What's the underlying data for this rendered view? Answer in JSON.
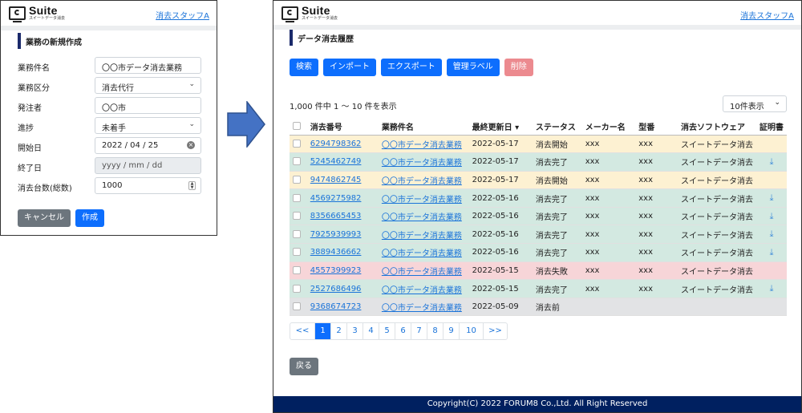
{
  "app": {
    "logo_title": "Suite",
    "logo_subtitle": "スイートデータ消去",
    "user": "消去スタッフA"
  },
  "new_job": {
    "title": "業務の新規作成",
    "fields": [
      {
        "label": "業務件名",
        "value": "〇〇市データ消去業務",
        "kind": "text"
      },
      {
        "label": "業務区分",
        "value": "消去代行",
        "kind": "select"
      },
      {
        "label": "発注者",
        "value": "〇〇市",
        "kind": "text"
      },
      {
        "label": "進捗",
        "value": "未着手",
        "kind": "select"
      },
      {
        "label": "開始日",
        "value": "2022 / 04 / 25",
        "kind": "date"
      },
      {
        "label": "終了日",
        "value": "yyyy / mm / dd",
        "kind": "disabled"
      },
      {
        "label": "消去台数(総数)",
        "value": "1000",
        "kind": "number"
      }
    ],
    "cancel_label": "キャンセル",
    "create_label": "作成"
  },
  "history": {
    "title": "データ消去履歴",
    "actions": {
      "search": "検索",
      "import": "インポート",
      "export": "エクスポート",
      "labels": "管理ラベル",
      "delete": "削除"
    },
    "count_text": "1,000 件中 1 〜 10 件を表示",
    "per_page": "10件表示",
    "columns": [
      "消去番号",
      "業務件名",
      "最終更新日 ▾",
      "ステータス",
      "メーカー名",
      "型番",
      "消去ソフトウェア",
      "証明書"
    ],
    "rows": [
      {
        "id": "6294798362",
        "job": "〇〇市データ消去業務",
        "date": "2022-05-17",
        "status": "消去開始",
        "maker": "xxx",
        "model": "xxx",
        "software": "スイートデータ消去",
        "cert": "",
        "state": "start"
      },
      {
        "id": "5245462749",
        "job": "〇〇市データ消去業務",
        "date": "2022-05-17",
        "status": "消去完了",
        "maker": "xxx",
        "model": "xxx",
        "software": "スイートデータ消去",
        "cert": "download-icon",
        "state": "done"
      },
      {
        "id": "9474862745",
        "job": "〇〇市データ消去業務",
        "date": "2022-05-17",
        "status": "消去開始",
        "maker": "xxx",
        "model": "xxx",
        "software": "スイートデータ消去",
        "cert": "",
        "state": "start"
      },
      {
        "id": "4569275982",
        "job": "〇〇市データ消去業務",
        "date": "2022-05-16",
        "status": "消去完了",
        "maker": "xxx",
        "model": "xxx",
        "software": "スイートデータ消去",
        "cert": "download-icon",
        "state": "done"
      },
      {
        "id": "8356665453",
        "job": "〇〇市データ消去業務",
        "date": "2022-05-16",
        "status": "消去完了",
        "maker": "xxx",
        "model": "xxx",
        "software": "スイートデータ消去",
        "cert": "download-icon",
        "state": "done"
      },
      {
        "id": "7925939993",
        "job": "〇〇市データ消去業務",
        "date": "2022-05-16",
        "status": "消去完了",
        "maker": "xxx",
        "model": "xxx",
        "software": "スイートデータ消去",
        "cert": "download-icon",
        "state": "done"
      },
      {
        "id": "3889436662",
        "job": "〇〇市データ消去業務",
        "date": "2022-05-16",
        "status": "消去完了",
        "maker": "xxx",
        "model": "xxx",
        "software": "スイートデータ消去",
        "cert": "download-icon",
        "state": "done"
      },
      {
        "id": "4557399923",
        "job": "〇〇市データ消去業務",
        "date": "2022-05-15",
        "status": "消去失敗",
        "maker": "xxx",
        "model": "xxx",
        "software": "スイートデータ消去",
        "cert": "",
        "state": "fail"
      },
      {
        "id": "2527686496",
        "job": "〇〇市データ消去業務",
        "date": "2022-05-15",
        "status": "消去完了",
        "maker": "xxx",
        "model": "xxx",
        "software": "スイートデータ消去",
        "cert": "download-icon",
        "state": "done"
      },
      {
        "id": "9368674723",
        "job": "〇〇市データ消去業務",
        "date": "2022-05-09",
        "status": "消去前",
        "maker": "",
        "model": "",
        "software": "",
        "cert": "",
        "state": "pre"
      }
    ],
    "pagination": {
      "prev": "<<",
      "pages": [
        "1",
        "2",
        "3",
        "4",
        "5",
        "6",
        "7",
        "8",
        "9",
        "10"
      ],
      "next": ">>",
      "current": "1"
    },
    "back_label": "戻る",
    "footer": "Copyright(C) 2022 FORUM8 Co.,Ltd. All Right Reserved"
  },
  "colors": {
    "primary": "#0d6efd",
    "navy": "#002060",
    "start_row": "#fdf1d2",
    "done_row": "#d3e9e1",
    "fail_row": "#f7d5d8",
    "pre_row": "#e2e3e5",
    "arrow": "#4472c4"
  }
}
